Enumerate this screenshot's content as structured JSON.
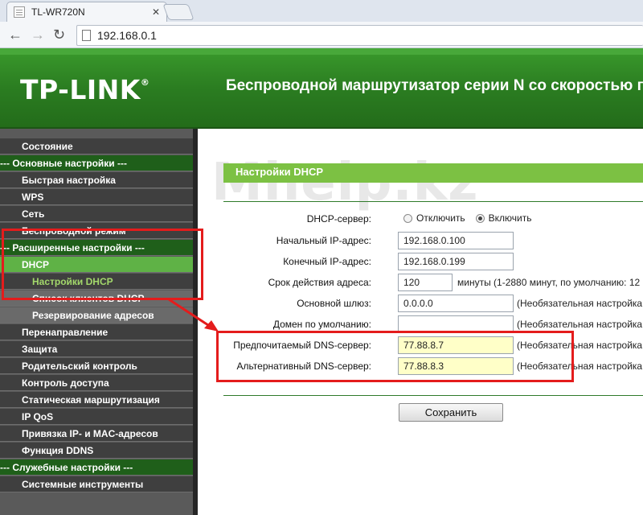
{
  "browser": {
    "tab_title": "TL-WR720N",
    "tab_close": "✕",
    "back": "←",
    "forward": "→",
    "reload": "↻",
    "url": "192.168.0.1"
  },
  "header": {
    "logo": "TP-LINK",
    "logo_mark": "®",
    "title": "Беспроводной маршрутизатор серии N со скоростью пе"
  },
  "watermark": "Mhelp.kz",
  "sidebar": {
    "items": [
      {
        "label": "Состояние"
      },
      {
        "label": "--- Основные настройки ---"
      },
      {
        "label": "Быстрая настройка"
      },
      {
        "label": "WPS"
      },
      {
        "label": "Сеть"
      },
      {
        "label": "Беспроводной режим"
      },
      {
        "label": "--- Расширенные настройки ---"
      },
      {
        "label": "DHCP"
      },
      {
        "label": "Настройки DHCP"
      },
      {
        "label": "Список клиентов DHCP"
      },
      {
        "label": "Резервирование адресов"
      },
      {
        "label": "Перенаправление"
      },
      {
        "label": "Защита"
      },
      {
        "label": "Родительский контроль"
      },
      {
        "label": "Контроль доступа"
      },
      {
        "label": "Статическая маршрутизация"
      },
      {
        "label": "IP QoS"
      },
      {
        "label": "Привязка IP- и MAC-адресов"
      },
      {
        "label": "Функция DDNS"
      },
      {
        "label": "--- Служебные настройки ---"
      },
      {
        "label": "Системные инструменты"
      }
    ]
  },
  "dhcp": {
    "section_title": "Настройки DHCP",
    "server_label": "DHCP-сервер:",
    "radio_off": "Отключить",
    "radio_on": "Включить",
    "start_ip_label": "Начальный IP-адрес:",
    "start_ip": "192.168.0.100",
    "end_ip_label": "Конечный IP-адрес:",
    "end_ip": "192.168.0.199",
    "lease_label": "Срок действия адреса:",
    "lease": "120",
    "lease_hint": "минуты (1-2880 минут, по умолчанию: 12",
    "gateway_label": "Основной шлюз:",
    "gateway": "0.0.0.0",
    "optional_hint": "(Необязательная настройка",
    "domain_label": "Домен по умолчанию:",
    "domain": "",
    "dns1_label": "Предпочитаемый DNS-сервер:",
    "dns1": "77.88.8.7",
    "dns2_label": "Альтернативный DNS-сервер:",
    "dns2": "77.88.8.3",
    "save_label": "Сохранить"
  }
}
